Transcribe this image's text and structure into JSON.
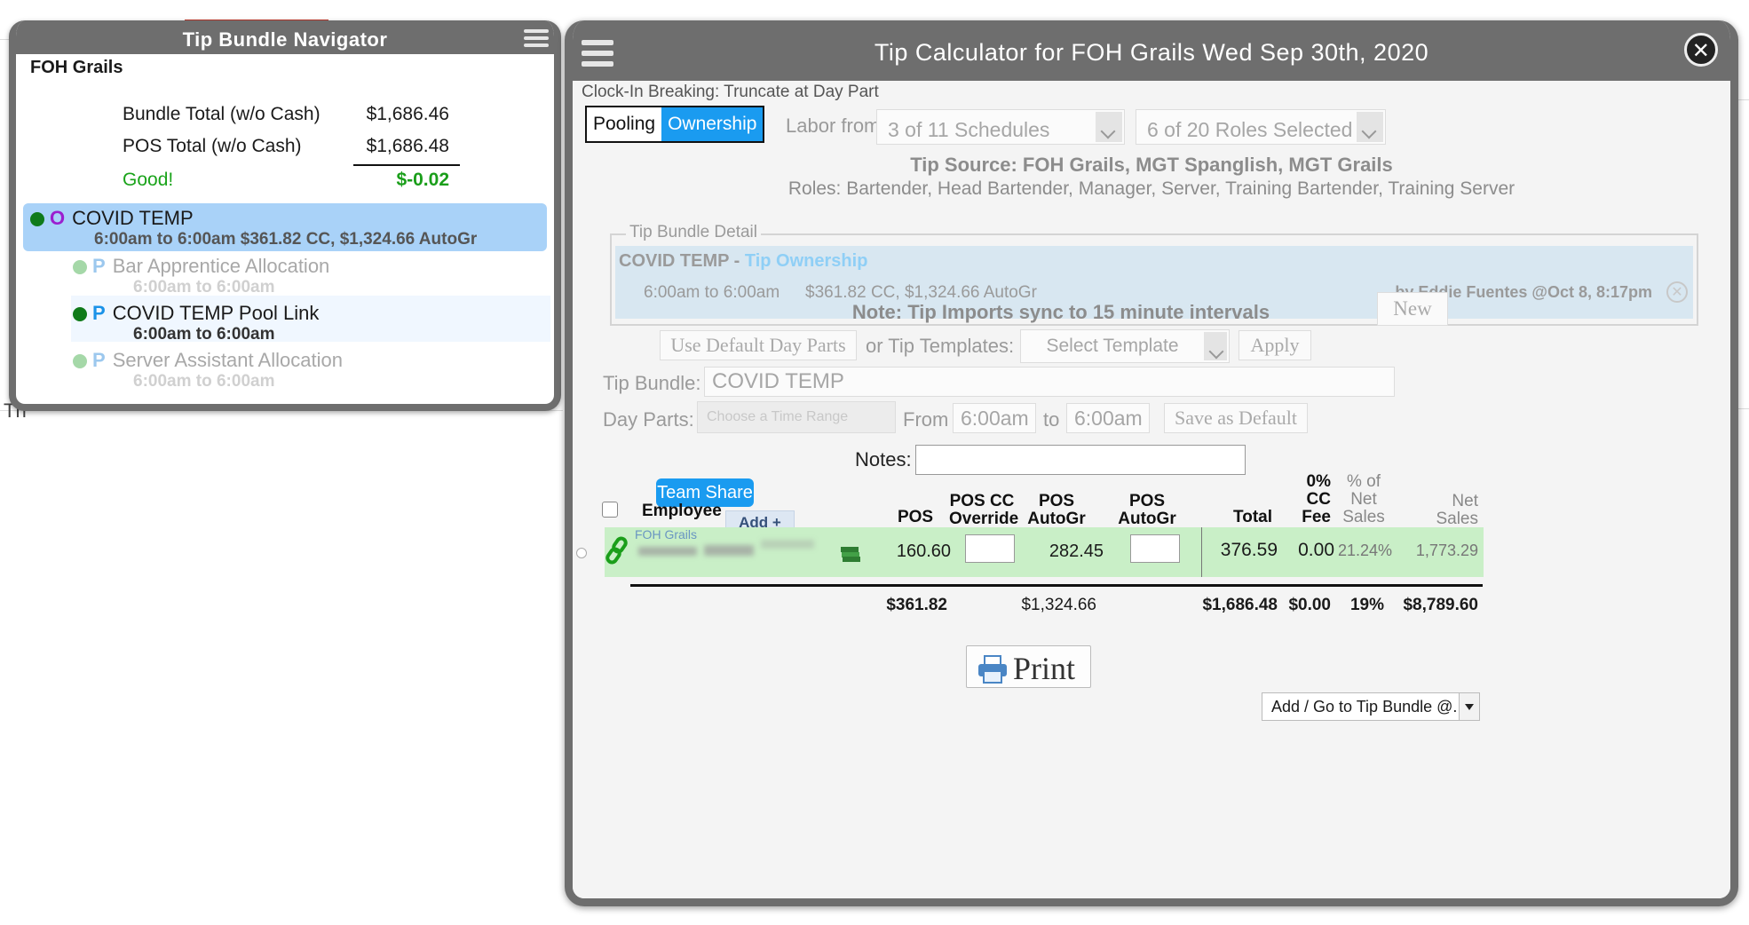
{
  "navigator": {
    "title": "Tip Bundle Navigator",
    "location": "FOH Grails",
    "bundle_total_label": "Bundle Total (w/o Cash)",
    "bundle_total_value": "$1,686.46",
    "pos_total_label": "POS Total (w/o Cash)",
    "pos_total_value": "$1,686.48",
    "status_label": "Good!",
    "difference": "$-0.02",
    "items": [
      {
        "letter": "O",
        "name": "COVID TEMP",
        "detail": "6:00am to 6:00am $361.82 CC, $1,324.66 AutoGr"
      },
      {
        "letter": "P",
        "name": "Bar Apprentice Allocation",
        "detail": "6:00am to 6:00am"
      },
      {
        "letter": "P",
        "name": "COVID TEMP Pool Link",
        "detail": "6:00am to 6:00am"
      },
      {
        "letter": "P",
        "name": "Server Assistant Allocation",
        "detail": "6:00am to 6:00am"
      }
    ]
  },
  "calc": {
    "title": "Tip Calculator for FOH Grails Wed Sep 30th, 2020",
    "clock_in": "Clock-In Breaking: Truncate at Day Part",
    "mode_pooling": "Pooling",
    "mode_ownership": "Ownership",
    "labor_from_label": "Labor from",
    "schedules_select": "3 of 11 Schedules",
    "roles_select": "6 of 20 Roles Selected",
    "tip_source": "Tip Source: FOH Grails, MGT Spanglish, MGT Grails",
    "roles": "Roles: Bartender, Head Bartender, Manager, Server, Training Bartender, Training Server",
    "detail_legend": "Tip Bundle Detail",
    "detail_name": "COVID TEMP",
    "detail_sep": " - ",
    "detail_type": "Tip Ownership",
    "detail_time": "6:00am to 6:00am",
    "detail_amounts": "$361.82 CC, $1,324.66 AutoGr",
    "detail_by": "by Eddie Fuentes @Oct 8, 8:17pm",
    "note": "Note: Tip Imports sync to 15 minute intervals",
    "new_button": "New",
    "use_default_button": "Use Default Day Parts",
    "or_templates_label": "or Tip Templates:",
    "template_select": "Select Template",
    "apply_button": "Apply",
    "tip_bundle_label": "Tip Bundle:",
    "tip_bundle_value": "COVID TEMP",
    "day_parts_label": "Day Parts:",
    "day_parts_placeholder": "Choose a Time Range",
    "from_label": "From",
    "from_value": "6:00am",
    "to_label": "to",
    "to_value": "6:00am",
    "save_default_button": "Save as Default",
    "notes_label": "Notes:",
    "notes_value": "",
    "print_button": "Print",
    "goto_select": "Add / Go to Tip Bundle @..."
  },
  "table": {
    "team_share": "Team Share",
    "add_button": "Add +",
    "headers": {
      "employee": "Employee",
      "pos_cc": "POS CC",
      "pos_cc_override": "POS CC\nOverride",
      "pos_autogr": "POS\nAutoGr",
      "pos_autogr_override": "POS AutoGr\nOverride",
      "total": "Total",
      "cc_fee_total": "0%\nCC Fee\nTotal",
      "pct_net_sales": "% of\nNet\nSales",
      "net_sales": "Net\nSales"
    },
    "rows": [
      {
        "location": "FOH Grails",
        "pos_cc": "160.60",
        "pos_cc_override": "",
        "pos_autogr": "282.45",
        "pos_autogr_override": "",
        "total": "376.59",
        "cc_fee_total": "0.00",
        "pct_net_sales": "21.24%",
        "net_sales": "1,773.29"
      }
    ],
    "totals": {
      "pos_cc": "$361.82",
      "pos_autogr": "$1,324.66",
      "total": "$1,686.48",
      "cc_fee_total": "$0.00",
      "pct_net_sales": "19%",
      "net_sales": "$8,789.60"
    }
  },
  "colors": {
    "accent": "#1a9bf0",
    "good": "#1aa31a",
    "selected_row": "#a9d2f8",
    "employee_row": "#c9efc7",
    "title_bar": "#6e6e6e"
  },
  "icons": [
    "hamburger-menu-icon",
    "close-icon",
    "link-icon",
    "money-icon",
    "printer-icon",
    "dropdown-arrow-icon"
  ]
}
